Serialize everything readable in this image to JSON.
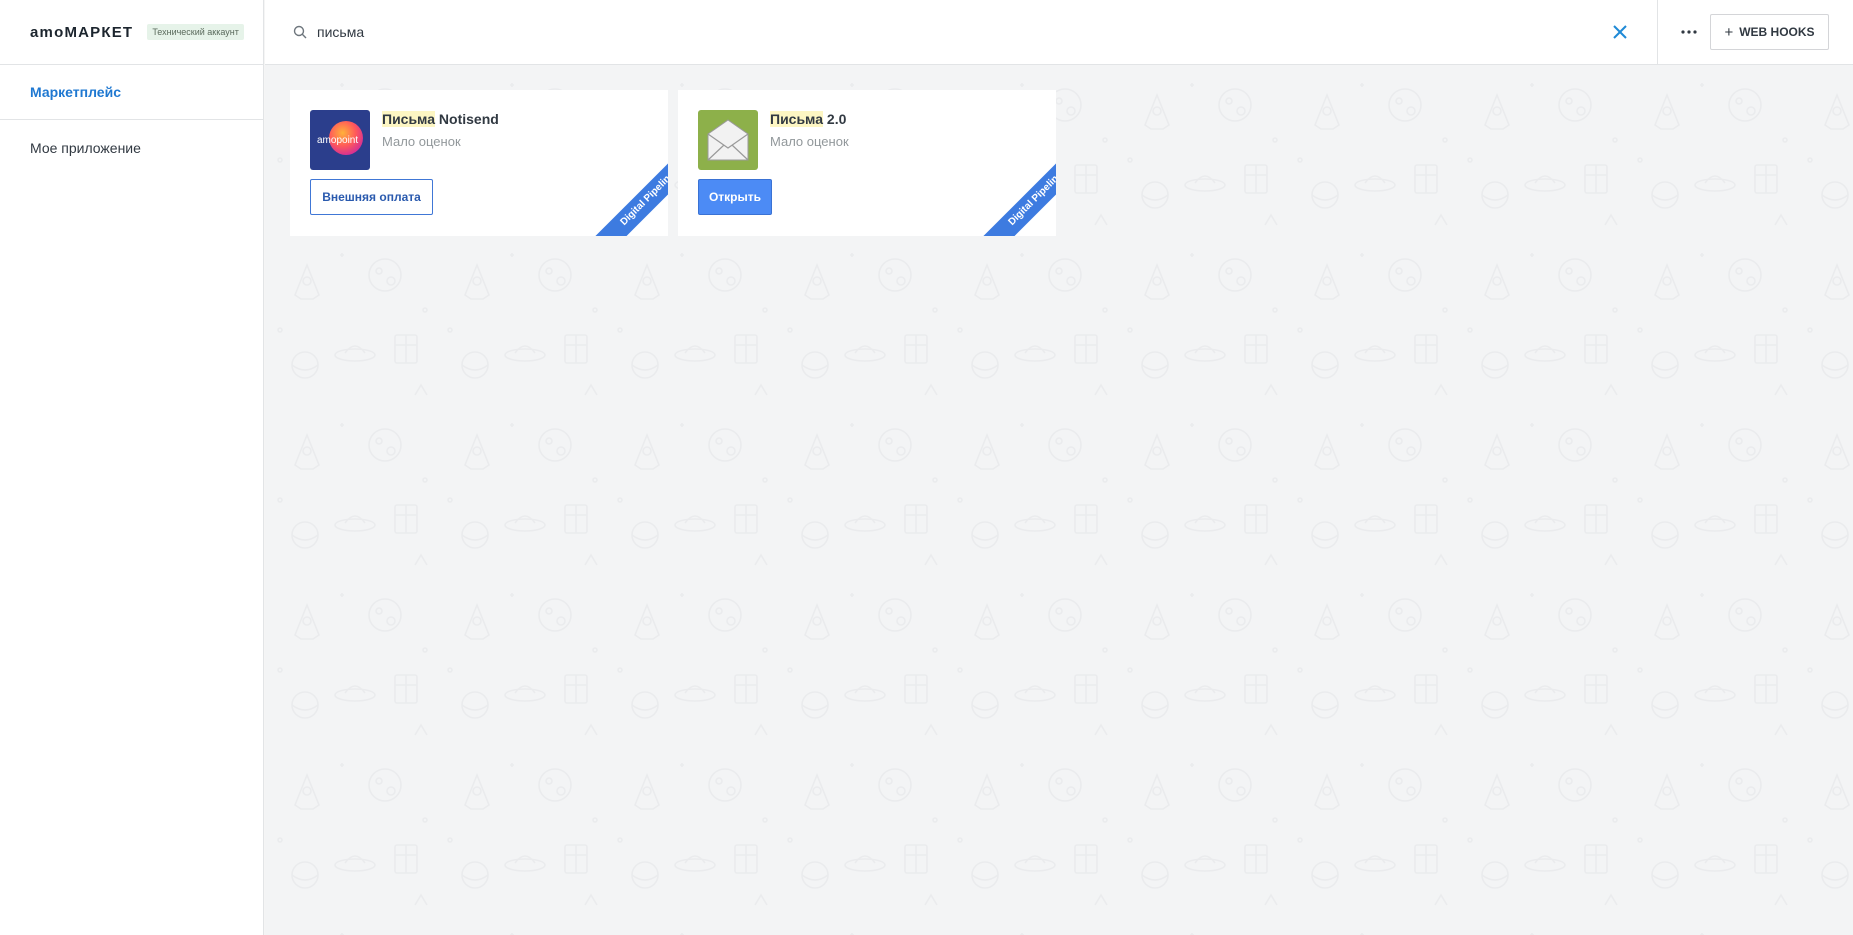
{
  "brand": {
    "logo": "amoМАРКЕТ",
    "badge": "Технический аккаунт"
  },
  "sidebar": {
    "items": [
      {
        "label": "Маркетплейс",
        "active": true
      },
      {
        "label": "Мое приложение",
        "active": false
      }
    ]
  },
  "header": {
    "search": {
      "value": "письма",
      "icon": "search-icon"
    },
    "clear_icon": "close-icon",
    "more_icon": "more-dots-icon",
    "webhooks_label": "WEB HOOKS"
  },
  "apps": [
    {
      "title_highlight": "Письма",
      "title_rest": " Notisend",
      "rating": "Мало оценок",
      "button_label": "Внешняя оплата",
      "ribbon": "Digital Pipeline",
      "icon": "amopoint-logo",
      "icon_text": "amopoint"
    },
    {
      "title_highlight": "Письма",
      "title_rest": " 2.0",
      "rating": "Мало оценок",
      "button_label": "Открыть",
      "ribbon": "Digital Pipeline",
      "icon": "envelope-icon"
    }
  ],
  "colors": {
    "accent": "#1f78d1",
    "primary_button": "#4c8bf5",
    "ribbon": "#3d7be0",
    "highlight": "#fdf6c3",
    "envelope_tile": "#8db04a",
    "amopoint_tile": "#2b3e8c"
  }
}
